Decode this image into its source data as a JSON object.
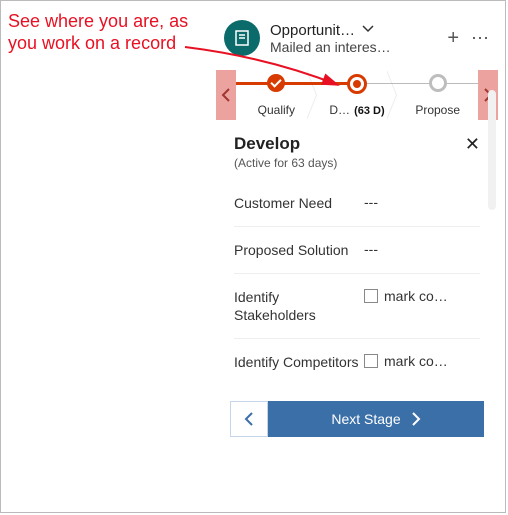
{
  "annotation": {
    "text": "See where you are, as\nyou work on a record"
  },
  "header": {
    "title": "Opportunit…",
    "subtitle": "Mailed an interes…"
  },
  "progress": {
    "stages": [
      {
        "label": "Qualify",
        "state": "done"
      },
      {
        "label": "D…",
        "days": "(63 D)",
        "state": "current"
      },
      {
        "label": "Propose",
        "state": "future"
      }
    ]
  },
  "detail": {
    "stage_name": "Develop",
    "active_text": "(Active for 63 days)",
    "fields": [
      {
        "label": "Customer Need",
        "value": "---",
        "type": "text"
      },
      {
        "label": "Proposed Solution",
        "value": "---",
        "type": "text"
      },
      {
        "label": "Identify Stakeholders",
        "value": "mark co…",
        "type": "check"
      },
      {
        "label": "Identify Competitors",
        "value": "mark co…",
        "type": "check"
      }
    ]
  },
  "footer": {
    "next_label": "Next Stage"
  }
}
